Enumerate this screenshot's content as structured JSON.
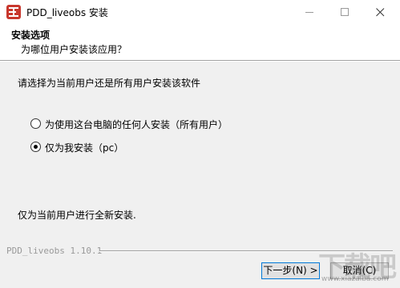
{
  "window": {
    "title": "PDD_liveobs 安装"
  },
  "header": {
    "title": "安装选项",
    "subtitle": "为哪位用户安装该应用？"
  },
  "body": {
    "prompt": "请选择为当前用户还是所有用户安装该软件",
    "options": [
      {
        "label": "为使用这台电脑的任何人安装（所有用户）",
        "selected": false
      },
      {
        "label": "仅为我安装（pc）",
        "selected": true
      }
    ],
    "info": "仅为当前用户进行全新安装."
  },
  "footer": {
    "brand": "PDD_liveobs 1.10.1",
    "next_label": "下一步(N) >",
    "cancel_label": "取消(C)"
  },
  "watermark": {
    "text": "下载吧",
    "sub": "www.xiazaiba.com"
  },
  "colors": {
    "app_icon": "#c8372d",
    "focus_border": "#0078d7"
  }
}
